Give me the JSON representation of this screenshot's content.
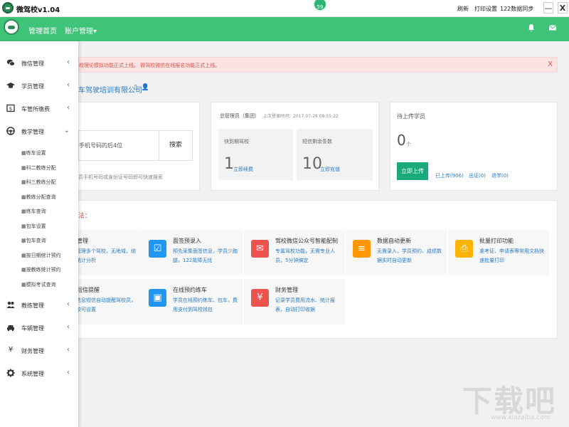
{
  "titlebar": {
    "title": "微驾校v1.04",
    "badge": "59",
    "links": [
      "刷新",
      "打印设置",
      "122数据同步"
    ],
    "minimize": "—",
    "close": "X"
  },
  "header": {
    "nav": [
      "管理首页",
      "账户管理▾"
    ],
    "icons": [
      "bell-icon",
      "mail-icon"
    ]
  },
  "sidebar": {
    "items": [
      {
        "label": "微信管理",
        "icon": "wechat-icon",
        "chevron": "‹"
      },
      {
        "label": "学员管理",
        "icon": "graduation-cap-icon",
        "chevron": "‹"
      },
      {
        "label": "车管所缴费",
        "icon": "money-icon",
        "chevron": "‹"
      },
      {
        "label": "教学管理",
        "icon": "steering-wheel-icon",
        "chevron": "⌄"
      }
    ],
    "sub_items": [
      "练车设置",
      "科二教练分配",
      "科三教练分配",
      "教练分配查询",
      "练车查询",
      "包车设置",
      "包车查询",
      "按日期统计预约",
      "按教练统计预约",
      "模拟考试查询"
    ],
    "items_bottom": [
      {
        "label": "教练管理",
        "icon": "users-icon",
        "chevron": "‹"
      },
      {
        "label": "车辆管理",
        "icon": "car-icon",
        "chevron": "‹"
      },
      {
        "label": "财务管理",
        "icon": "yen-icon",
        "chevron": "‹"
      },
      {
        "label": "系统管理",
        "icon": "gear-icon",
        "chevron": "‹"
      }
    ]
  },
  "alert": {
    "text": "校理论模拟功能正式上线。 微驾校微信在线报名功能正式上线。",
    "close": "X"
  },
  "company": {
    "name": "车驾驶培训有限公司",
    "icons": [
      "phone-icon",
      "user-icon"
    ]
  },
  "search": {
    "text": "手机号码的后4位",
    "button": "搜索",
    "hint": "员手机号码或身份证号码即可快速搜索"
  },
  "admin": {
    "role": "总管理员（集团）",
    "last_login": "上次登录时间：2017-07-28 09:55:22",
    "expiry": {
      "label": "快到期驾校",
      "value": "1",
      "link": "立即续费"
    },
    "sms": {
      "label": "短信剩余条数",
      "value": "10",
      "link": "立即充值"
    }
  },
  "upload": {
    "title": "待上传学员",
    "count": "0",
    "unit": "个",
    "button": "立即上传",
    "links": [
      "已上传(906)",
      "出证(0)",
      "退学(0)"
    ]
  },
  "features": {
    "title": "法：",
    "items": [
      {
        "name": "化管理",
        "desc": "时管理多个驾校，无地域，综合统计分析",
        "icon": "building-icon",
        "color": "#ffffff"
      },
      {
        "name": "面签预录入",
        "desc": "预先采集面签信息，学员少跑腿，122故障无忧",
        "icon": "calendar-icon",
        "color": "#2196f3"
      },
      {
        "name": "驾校微信公众号智能配制",
        "desc": "专属驾校功能，无需专业人员，5分钟搞定",
        "icon": "wechat-icon",
        "color": "#ef5350"
      },
      {
        "name": "数据自动更新",
        "desc": "无需录入，学员预约、成绩数据实时自动更新",
        "icon": "database-icon",
        "color": "#ff9800"
      },
      {
        "name": "批量打印功能",
        "desc": "准考证、申请表等常用文档快速批量打印",
        "icon": "printer-icon",
        "color": "#ffb300"
      },
      {
        "name": "息短信提醒",
        "desc": "新信息短信自动提醒驾校员，驾校可设置",
        "icon": "message-icon",
        "color": "#ffffff"
      },
      {
        "name": "在线预约练车",
        "desc": "学员在线预约练车、包车，费用支付到驾校钱包",
        "icon": "car-icon",
        "color": "#2196f3"
      },
      {
        "name": "财务管理",
        "desc": "记录学员费用流水、统计报表，自动打印收据",
        "icon": "yen-icon",
        "color": "#ef5350"
      }
    ]
  },
  "watermark": {
    "main": "下载吧",
    "sub": "www.xiazaiba.com"
  }
}
